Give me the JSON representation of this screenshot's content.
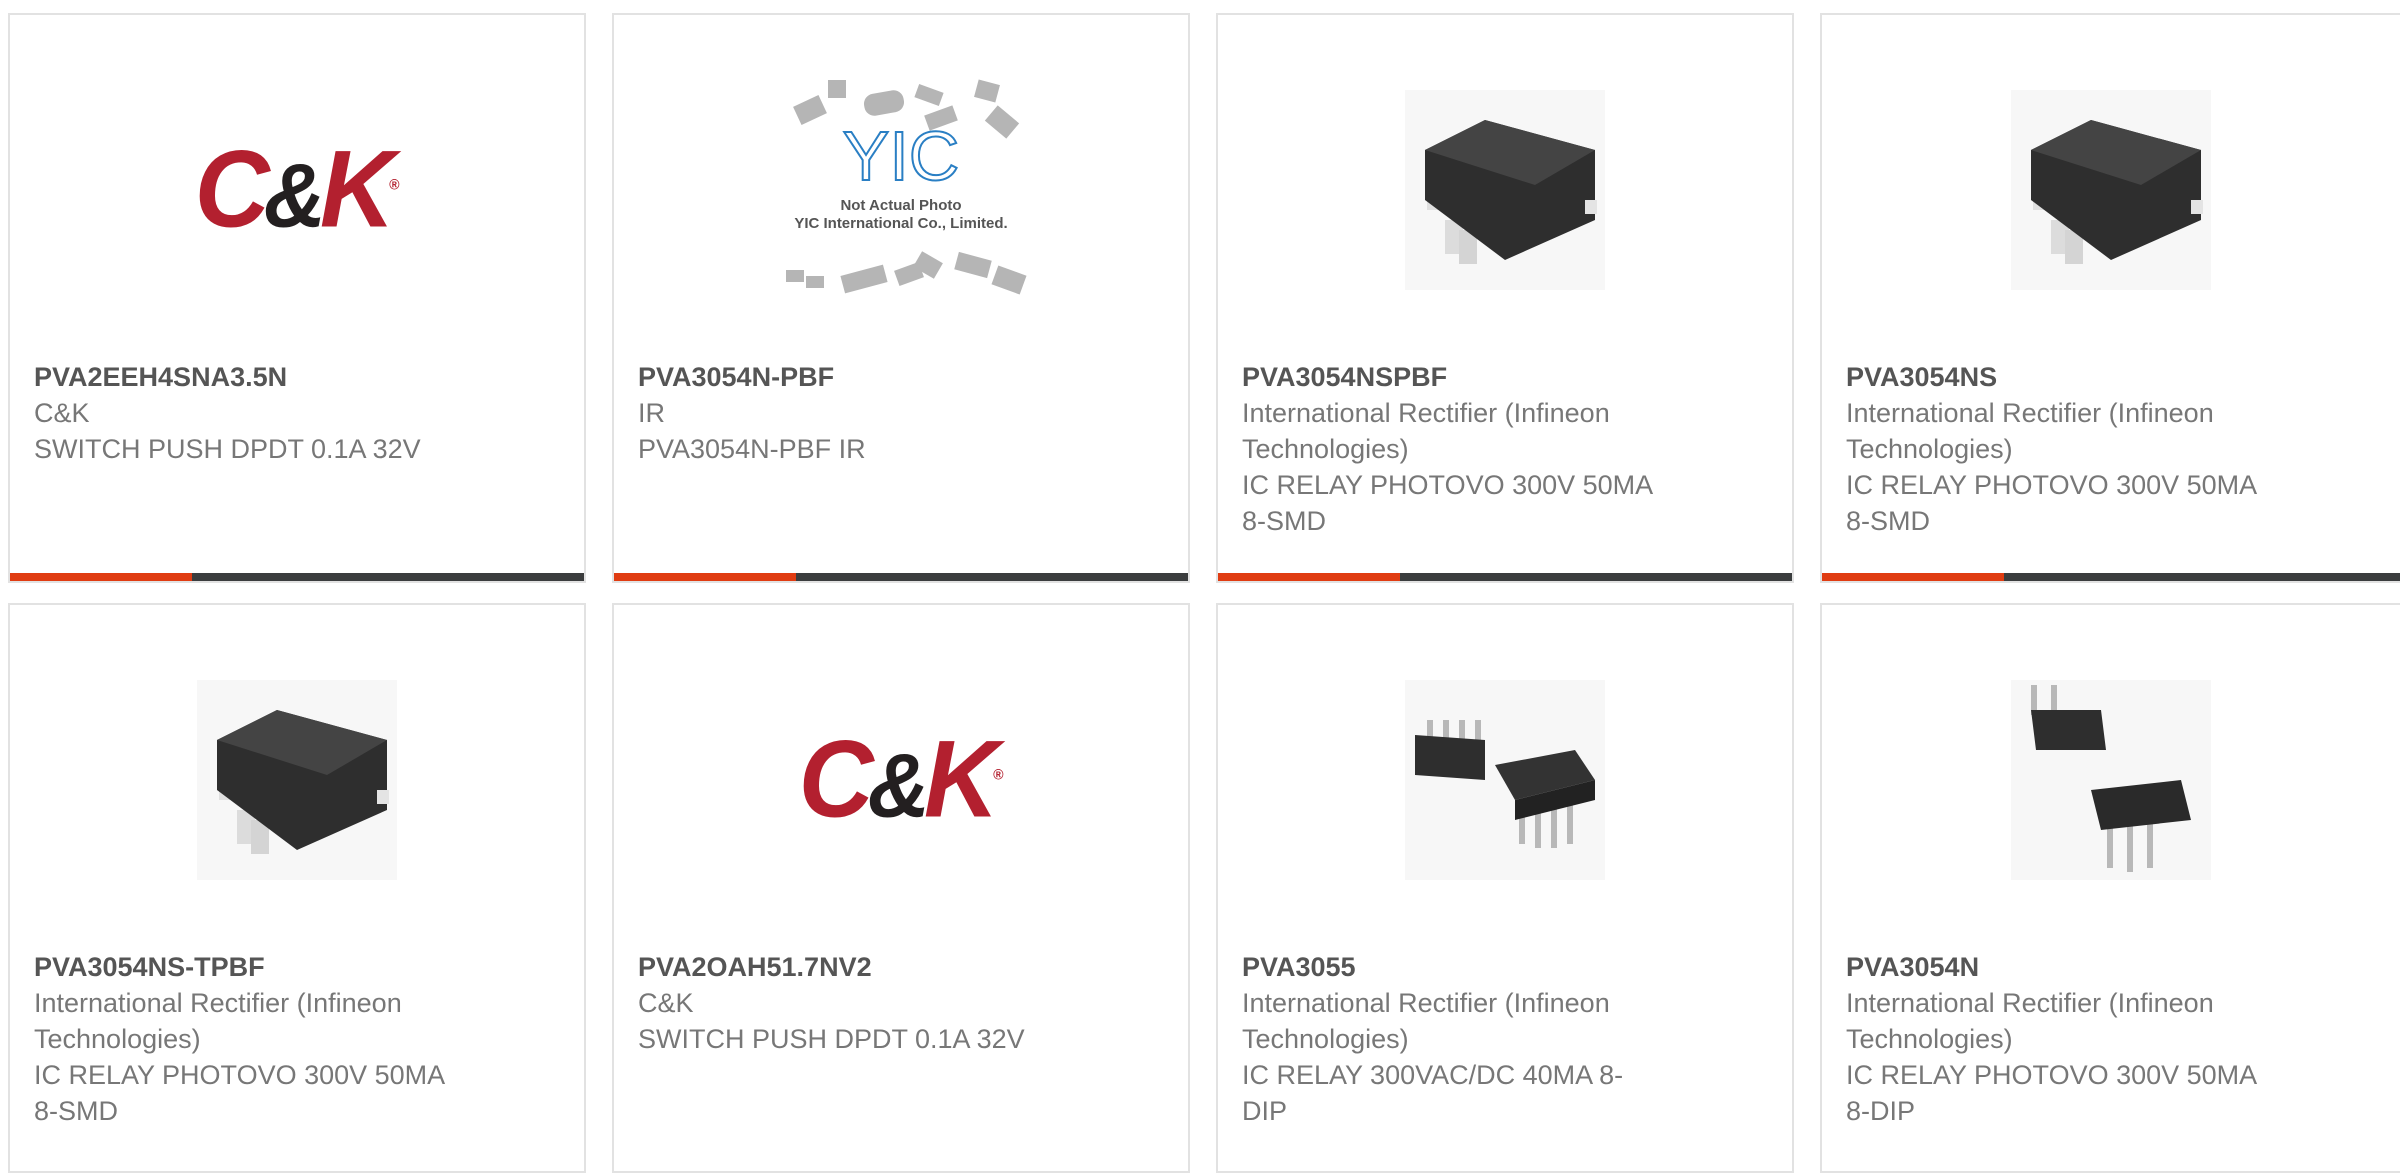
{
  "colors": {
    "accent_bar": "#e03c12",
    "dark_bar": "#3b3d3e",
    "ck_red": "#b3202f"
  },
  "products": [
    {
      "part": "PVA2EEH4SNA3.5N",
      "manufacturer": "C&K",
      "description": "SWITCH PUSH DPDT 0.1A 32V",
      "image": "ck-logo",
      "bar": "bar-visible"
    },
    {
      "part": "PVA3054N-PBF",
      "manufacturer": "IR",
      "description": "PVA3054N-PBF IR",
      "image": "yic-placeholder",
      "bar": "bar-visible"
    },
    {
      "part": "PVA3054NSPBF",
      "manufacturer": "International Rectifier (Infineon Technologies)",
      "description": "IC RELAY PHOTOVO 300V 50MA 8-SMD",
      "image": "smd-relay",
      "bar": "bar-visible"
    },
    {
      "part": "PVA3054NS",
      "manufacturer": "International Rectifier (Infineon Technologies)",
      "description": "IC RELAY PHOTOVO 300V 50MA 8-SMD",
      "image": "smd-relay",
      "bar": "bar-visible"
    },
    {
      "part": "PVA3054NS-TPBF",
      "manufacturer": "International Rectifier (Infineon Technologies)",
      "description": "IC RELAY PHOTOVO 300V 50MA 8-SMD",
      "image": "smd-relay"
    },
    {
      "part": "PVA2OAH51.7NV2",
      "manufacturer": "C&K",
      "description": "SWITCH PUSH DPDT 0.1A 32V",
      "image": "ck-logo"
    },
    {
      "part": "PVA3055",
      "manufacturer": "International Rectifier (Infineon Technologies)",
      "description": "IC RELAY 300VAC/DC 40MA 8-DIP",
      "image": "dip-chips"
    },
    {
      "part": "PVA3054N",
      "manufacturer": "International Rectifier (Infineon Technologies)",
      "description": "IC RELAY PHOTOVO 300V 50MA 8-DIP",
      "image": "dip-chips-2"
    }
  ],
  "logo_text": {
    "ck_main": "C",
    "ck_amp": "&",
    "ck_end": "K",
    "ck_reg": "®",
    "yic_mark": "YIC",
    "yic_line1": "Not Actual Photo",
    "yic_line2": "YIC International Co., Limited."
  }
}
